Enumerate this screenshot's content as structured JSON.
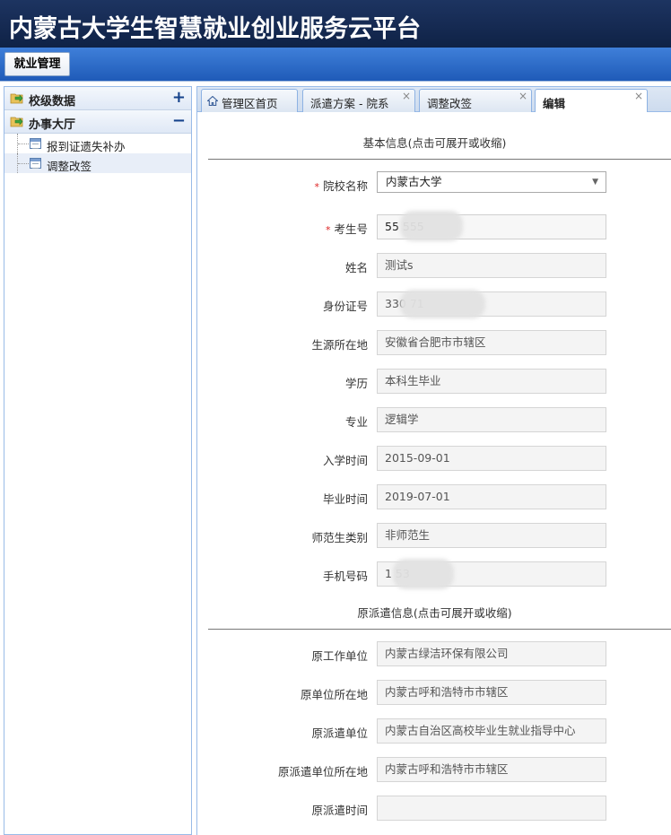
{
  "app": {
    "title": "内蒙古大学生智慧就业创业服务云平台"
  },
  "menubar": {
    "item": "就业管理"
  },
  "sidebar": {
    "sections": [
      {
        "label": "校级数据",
        "toggle": "+"
      },
      {
        "label": "办事大厅",
        "toggle": "−"
      }
    ],
    "items": [
      {
        "label": "报到证遗失补办"
      },
      {
        "label": "调整改签"
      }
    ]
  },
  "tabs": [
    {
      "label": "管理区首页",
      "icon": "home-icon"
    },
    {
      "label": "派遣方案 - 院系",
      "close": "×"
    },
    {
      "label": "调整改签",
      "close": "×"
    },
    {
      "label": "编辑",
      "close": "×"
    }
  ],
  "form": {
    "basic_title": "基本信息(点击可展开或收缩)",
    "orig_title": "原派遣信息(点击可展开或收缩)",
    "required_mark": "*",
    "school": {
      "label": "院校名称",
      "value": "内蒙古大学",
      "caret": "▼"
    },
    "exam_no": {
      "label": "考生号",
      "value": "55          555"
    },
    "name": {
      "label": "姓名",
      "value": "测试s"
    },
    "id_no": {
      "label": "身份证号",
      "value": "330                       71"
    },
    "origin": {
      "label": "生源所在地",
      "value": "安徽省合肥市市辖区"
    },
    "education": {
      "label": "学历",
      "value": "本科生毕业"
    },
    "major": {
      "label": "专业",
      "value": "逻辑学"
    },
    "enroll": {
      "label": "入学时间",
      "value": "2015-09-01"
    },
    "graduate": {
      "label": "毕业时间",
      "value": "2019-07-01"
    },
    "normal_type": {
      "label": "师范生类别",
      "value": "非师范生"
    },
    "phone": {
      "label": "手机号码",
      "value": "1             53"
    },
    "orig_employer": {
      "label": "原工作单位",
      "value": "内蒙古绿洁环保有限公司"
    },
    "orig_employer_loc": {
      "label": "原单位所在地",
      "value": "内蒙古呼和浩特市市辖区"
    },
    "orig_dispatch": {
      "label": "原派遣单位",
      "value": "内蒙古自治区高校毕业生就业指导中心"
    },
    "orig_dispatch_loc": {
      "label": "原派遣单位所在地",
      "value": "内蒙古呼和浩特市市辖区"
    },
    "orig_dispatch_time": {
      "label": "原派遣时间",
      "value": ""
    }
  },
  "colors": {
    "header": "#0f2246",
    "menubar": "#2a66c4",
    "border": "#99bbe8",
    "required": "#dd2222"
  }
}
